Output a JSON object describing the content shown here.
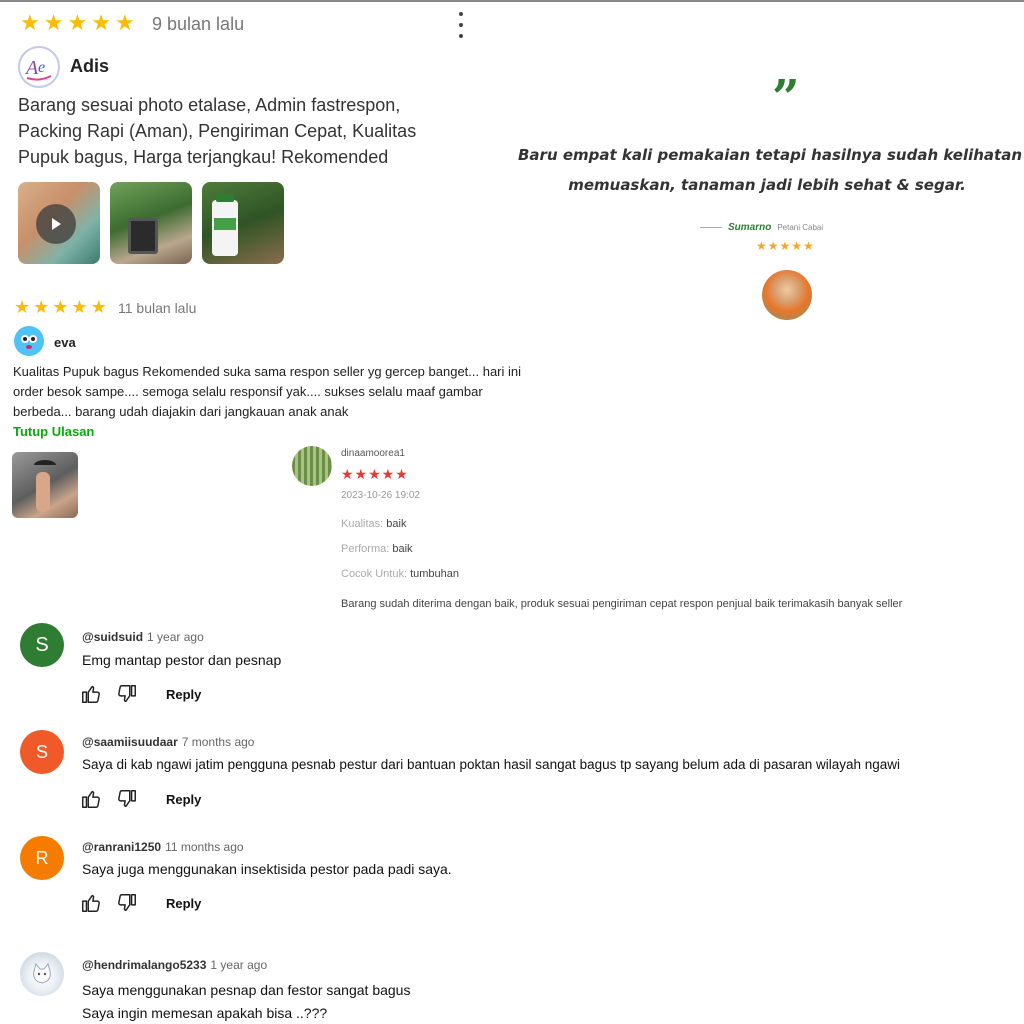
{
  "review1": {
    "stars": [
      "★",
      "★",
      "★",
      "★",
      "★"
    ],
    "time": "9 bulan lalu",
    "name": "Adis",
    "text_lines": [
      "Barang sesuai photo etalase, Admin fastrespon,",
      "Packing Rapi (Aman), Pengiriman Cepat, Kualitas",
      "Pupuk bagus, Harga terjangkau! Rekomended"
    ],
    "photos": [
      "video-thumbnail",
      "plant-photo",
      "product-photo"
    ]
  },
  "testimonial": {
    "quote_mark": "”",
    "line1": "Baru empat kali pemakaian tetapi hasilnya sudah kelihatan",
    "line2": "memuaskan, tanaman jadi lebih sehat & segar.",
    "author": "Sumarno",
    "role": "Petani Cabai",
    "stars": "★★★★★"
  },
  "review2": {
    "stars": [
      "★",
      "★",
      "★",
      "★",
      "★"
    ],
    "time": "11 bulan lalu",
    "name": "eva",
    "text_lines": [
      "Kualitas Pupuk bagus Rekomended suka sama respon seller yg gercep banget... hari ini",
      "order besok sampe.... semoga selalu responsif yak.... sukses selalu maaf gambar",
      "berbeda... barang udah diajakin dari jangkauan anak anak"
    ],
    "collapse_link": "Tutup Ulasan"
  },
  "review3": {
    "username": "dinaamoorea1",
    "stars": "★★★★★",
    "date": "2023-10-26 19:02",
    "fields": [
      {
        "label": "Kualitas:",
        "value": "baik"
      },
      {
        "label": "Performa:",
        "value": "baik"
      },
      {
        "label": "Cocok Untuk:",
        "value": "tumbuhan"
      }
    ],
    "text": "Barang sudah diterima dengan baik, produk sesuai pengiriman cepat respon penjual baik terimakasih banyak seller"
  },
  "comments": [
    {
      "initial": "S",
      "color": "#2e7d32",
      "handle": "@suidsuid",
      "time": "1 year ago",
      "lines": [
        "Emg mantap pestor dan pesnap"
      ],
      "reply": "Reply"
    },
    {
      "initial": "S",
      "color": "#ef5a28",
      "handle": "@saamiisuudaar",
      "time": "7 months ago",
      "lines": [
        "Saya di kab ngawi jatim pengguna pesnab pestur dari bantuan poktan hasil sangat bagus tp sayang belum ada di pasaran wilayah ngawi"
      ],
      "reply": "Reply"
    },
    {
      "initial": "R",
      "color": "#f57c00",
      "handle": "@ranrani1250",
      "time": "11 months ago",
      "lines": [
        "Saya juga menggunakan insektisida pestor pada padi saya."
      ],
      "reply": "Reply"
    },
    {
      "initial": "",
      "color": "#dfe6ee",
      "handle": "@hendrimalango5233",
      "time": "1 year ago",
      "lines": [
        "Saya menggunakan pesnap dan festor sangat bagus",
        "Saya ingin memesan apakah bisa ..???"
      ],
      "reply": ""
    }
  ]
}
